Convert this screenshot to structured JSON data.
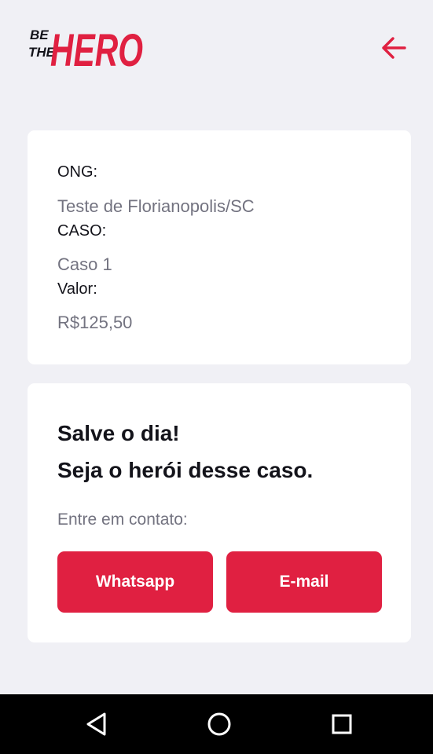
{
  "header": {
    "logo_text_small_1": "BE",
    "logo_text_small_2": "THE",
    "logo_text_big": "HERO",
    "back_icon": "arrow-left-icon"
  },
  "incident": {
    "ong_label": "ONG:",
    "ong_value": "Teste de Florianopolis/SC",
    "case_label": "CASO:",
    "case_value": "Caso 1",
    "value_label": "Valor:",
    "value_value": "R$125,50"
  },
  "contact": {
    "title_line1": "Salve o dia!",
    "title_line2": "Seja o herói desse caso.",
    "description": "Entre em contato:",
    "whatsapp_label": "Whatsapp",
    "email_label": "E-mail"
  },
  "navbar": {
    "back_icon": "triangle-back-icon",
    "home_icon": "circle-home-icon",
    "recent_icon": "square-recent-icon"
  },
  "colors": {
    "accent": "#e02041",
    "background": "#f0f0f5",
    "text_dark": "#13131a",
    "text_muted": "#737380"
  }
}
